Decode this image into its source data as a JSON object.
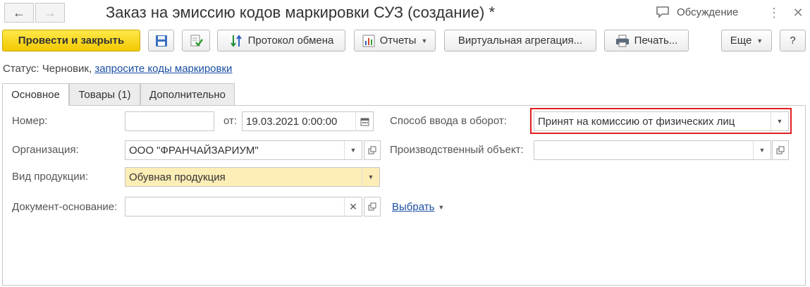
{
  "title": "Заказ на эмиссию кодов маркировки СУЗ (создание) *",
  "discussion_label": "Обсуждение",
  "toolbar": {
    "post_and_close": "Провести и закрыть",
    "exchange_log": "Протокол обмена",
    "reports": "Отчеты",
    "virtual_aggregation": "Виртуальная агрегация...",
    "print": "Печать...",
    "more": "Еще",
    "help": "?"
  },
  "status": {
    "label": "Статус:",
    "value": "Черновик,",
    "link": "запросите коды маркировки"
  },
  "tabs": [
    {
      "label": "Основное"
    },
    {
      "label": "Товары (1)"
    },
    {
      "label": "Дополнительно"
    }
  ],
  "form": {
    "number_label": "Номер:",
    "number_value": "",
    "date_label": "от:",
    "date_value": "19.03.2021  0:00:00",
    "organization_label": "Организация:",
    "organization_value": "ООО \"ФРАНЧАЙЗАРИУМ\"",
    "product_type_label": "Вид продукции:",
    "product_type_value": "Обувная продукция",
    "base_doc_label": "Документ-основание:",
    "base_doc_value": "",
    "choose_link": "Выбрать",
    "entry_method_label": "Способ ввода в оборот:",
    "entry_method_value": "Принят на комиссию от физических лиц",
    "production_object_label": "Производственный объект:",
    "production_object_value": ""
  },
  "colors": {
    "primary_button": "#f2c800",
    "highlight_border": "#e02020",
    "link": "#1a4fa3",
    "required_field": "#fdedb6"
  }
}
